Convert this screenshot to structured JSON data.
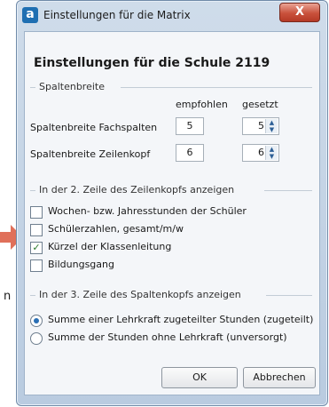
{
  "window": {
    "title": "Einstellungen für die Matrix",
    "close_label": "X",
    "app_icon": "a"
  },
  "dialog": {
    "heading": "Einstellungen für die Schule 2119",
    "column_width": {
      "group_label": "Spaltenbreite",
      "col_recommended": "empfohlen",
      "col_set": "gesetzt",
      "rows": [
        {
          "label": "Spaltenbreite Fachspalten",
          "recommended": "5",
          "set": "5"
        },
        {
          "label": "Spaltenbreite Zeilenkopf",
          "recommended": "6",
          "set": "6"
        }
      ]
    },
    "row_header": {
      "group_label": "In der 2. Zeile des Zeilenkopfs anzeigen",
      "options": [
        {
          "label": "Wochen- bzw. Jahresstunden der Schüler",
          "checked": false
        },
        {
          "label": "Schülerzahlen, gesamt/m/w",
          "checked": false
        },
        {
          "label": "Kürzel der Klassenleitung",
          "checked": true
        },
        {
          "label": "Bildungsgang",
          "checked": false
        }
      ]
    },
    "column_header": {
      "group_label": "In der 3. Zeile des Spaltenkopfs anzeigen",
      "options": [
        {
          "label": "Summe einer Lehrkraft zugeteilter Stunden (zugeteilt)",
          "selected": true
        },
        {
          "label": "Summe der Stunden ohne Lehrkraft (unversorgt)",
          "selected": false
        }
      ]
    },
    "buttons": {
      "ok": "OK",
      "cancel": "Abbrechen"
    }
  },
  "side_text": "n",
  "colors": {
    "arrow": "#e0705a",
    "radio_dot": "#2a6fb5",
    "check": "#2a7a2a"
  }
}
